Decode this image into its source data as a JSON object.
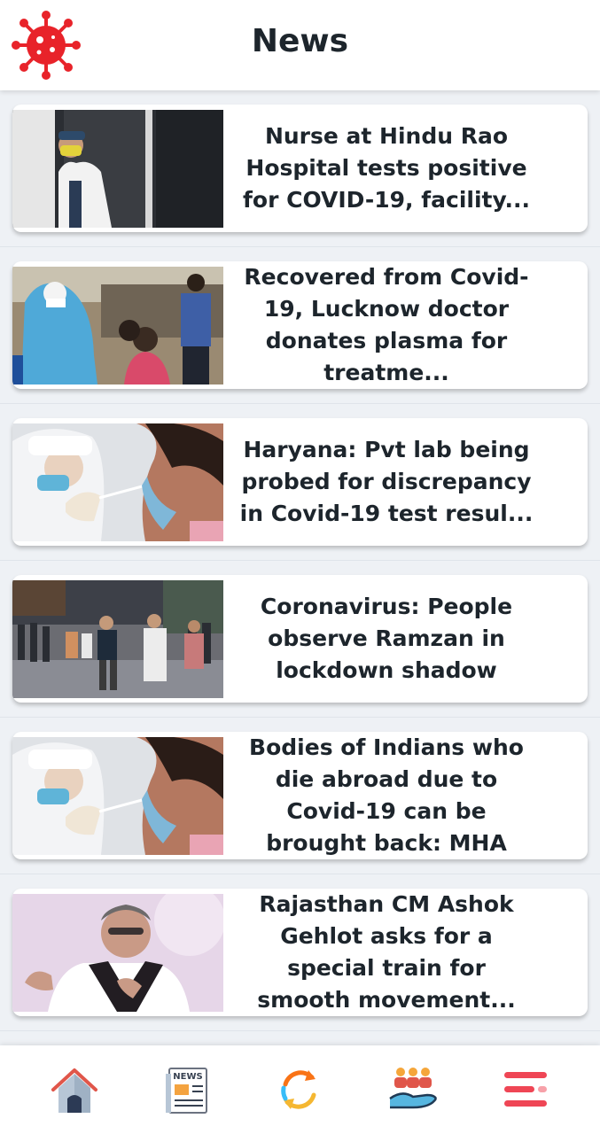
{
  "header": {
    "title": "News",
    "logo_icon": "virus-icon"
  },
  "articles": [
    {
      "title": "Nurse at Hindu Rao Hospital tests positive for COVID-19, facility...",
      "image": "nurse-window-photo"
    },
    {
      "title": "Recovered from Covid-19, Lucknow doctor donates plasma for treatme...",
      "image": "swab-test-photo"
    },
    {
      "title": "Haryana: Pvt lab being probed for discrepancy in Covid-19 test resul...",
      "image": "nasal-swab-photo"
    },
    {
      "title": "Coronavirus: People observe Ramzan in lockdown shadow",
      "image": "street-crowd-photo"
    },
    {
      "title": "Bodies of Indians who die abroad due to Covid-19 can be brought back: MHA",
      "image": "nasal-swab-photo"
    },
    {
      "title": "Rajasthan CM Ashok Gehlot asks for a special train for smooth movement...",
      "image": "politician-photo"
    }
  ],
  "bottom_nav": [
    {
      "name": "home",
      "icon": "home-icon"
    },
    {
      "name": "news",
      "icon": "newspaper-icon",
      "icon_text": "NEWS"
    },
    {
      "name": "refresh",
      "icon": "refresh-icon"
    },
    {
      "name": "community",
      "icon": "community-hand-icon"
    },
    {
      "name": "menu",
      "icon": "menu-icon"
    }
  ],
  "colors": {
    "accent": "#e8232a",
    "text": "#1d252c",
    "background": "#eef1f5"
  }
}
